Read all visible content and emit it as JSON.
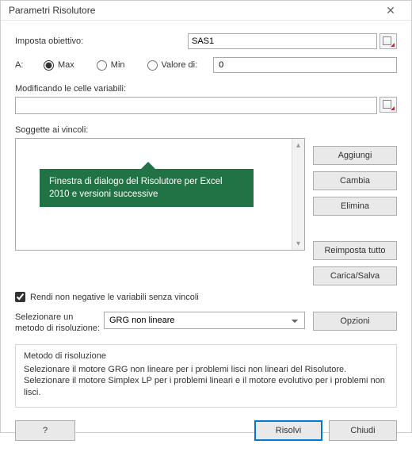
{
  "title": "Parametri Risolutore",
  "objective": {
    "label": "Imposta obiettivo:",
    "value": "SAS1"
  },
  "to": {
    "label": "A:",
    "max": "Max",
    "min": "Min",
    "value_of": "Valore di:",
    "value_input": "0"
  },
  "variables": {
    "label": "Modificando le celle variabili:",
    "value": ""
  },
  "constraints": {
    "label": "Soggette ai vincoli:"
  },
  "tooltip": "Finestra di dialogo del Risolutore per Excel 2010 e versioni successive",
  "buttons": {
    "add": "Aggiungi",
    "change": "Cambia",
    "delete": "Elimina",
    "reset": "Reimposta tutto",
    "loadsave": "Carica/Salva",
    "options": "Opzioni",
    "help": "?",
    "solve": "Risolvi",
    "close": "Chiudi"
  },
  "checkbox": {
    "label": "Rendi non negative le variabili senza vincoli"
  },
  "method": {
    "label": "Selezionare un metodo di risoluzione:",
    "selected": "GRG non lineare"
  },
  "group": {
    "title": "Metodo di risoluzione",
    "body": "Selezionare il motore GRG non lineare per i problemi lisci non lineari del Risolutore. Selezionare il motore Simplex LP per i problemi lineari e il motore evolutivo per i problemi non lisci."
  }
}
